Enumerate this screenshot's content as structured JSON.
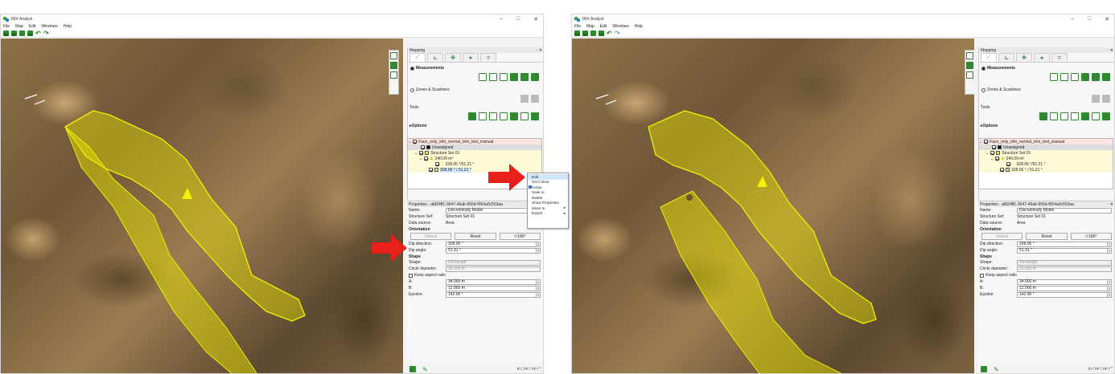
{
  "windows": [
    {
      "title": "IMX Analyst",
      "menu": [
        "File",
        "Map",
        "Edit",
        "Windows",
        "Help"
      ],
      "panel_title": "Mapping",
      "measurements_label": "Measurements",
      "zones_label": "Zones & Scanlines",
      "tools_label": "Tools",
      "options_label": "Options",
      "tree": {
        "root": "Face_only_sfm_normal_trim_test_manual",
        "unassigned": "Unassigned",
        "structure_set": "Structure Set 01",
        "area": "240.09 m²",
        "item1": "328.06 °/51.21 °",
        "item2": "328.06 ° / 51.21 °"
      },
      "properties_title": "Properties - afd24ff1-3647-46ab-956d-f054a0c553aa",
      "name_label": "Name:",
      "name_value": "Discontinuity Model",
      "structure_set_label": "Structure Set:",
      "structure_set_value": "Structure Set 01",
      "data_source_label": "Data source:",
      "data_source_value": "Area",
      "orientation_label": "Orientation",
      "unlock_label": "Unlock",
      "reset_label": "Reset",
      "rotate_label": "180°",
      "dip_direction_label": "Dip direction:",
      "dip_direction_value": "328.06 °",
      "dip_angle_label": "Dip angle:",
      "dip_angle_value": "51.31 °",
      "shape_section": "Shape",
      "shape_label": "Shape:",
      "shape_value": "Rectangle",
      "circle_label": "Circle diameter:",
      "circle_value": "25.000 m",
      "aspect_label": "Keep aspect ratio",
      "a_label": "A:",
      "a_value": "34.000 m",
      "b_label": "B:",
      "b_value": "12.000 m",
      "eps_label": "Epsilon:",
      "eps_value": "142.96 °",
      "units": "m / m² / m³ / °"
    },
    {
      "title": "IMX Analyst",
      "menu": [
        "File",
        "Map",
        "Edit",
        "Windows",
        "Help"
      ],
      "panel_title": "Mapping",
      "measurements_label": "Measurements",
      "zones_label": "Zones & Scanlines",
      "tools_label": "Tools",
      "options_label": "Options",
      "tree": {
        "root": "Face_only_sfm_normal_trim_test_manual",
        "unassigned": "Unassigned",
        "structure_set": "Structure Set 01",
        "area": "240.09 m²",
        "item1": "328.06 °/51.21 °",
        "item2": "328.06 ° / 51.21 °"
      },
      "properties_title": "Properties - afd24ff1-3647-46ab-956d-f054a0c553aa",
      "name_label": "Name:",
      "name_value": "Discontinuity Model",
      "structure_set_label": "Structure Set:",
      "structure_set_value": "Structure Set 01",
      "data_source_label": "Data source:",
      "data_source_value": "Area",
      "orientation_label": "Orientation",
      "unlock_label": "Unlock",
      "reset_label": "Reset",
      "rotate_label": "180°",
      "dip_direction_label": "Dip direction:",
      "dip_direction_value": "328.06 °",
      "dip_angle_label": "Dip angle:",
      "dip_angle_value": "51.31 °",
      "shape_section": "Shape",
      "shape_label": "Shape:",
      "shape_value": "Rectangle",
      "circle_label": "Circle diameter:",
      "circle_value": "25.000 m",
      "aspect_label": "Keep aspect ratio",
      "a_label": "A:",
      "a_value": "34.000 m",
      "b_label": "B:",
      "b_value": "12.000 m",
      "eps_label": "Epsilon:",
      "eps_value": "142.96 °",
      "units": "m / m² / m³ / °"
    }
  ],
  "context_menu": [
    {
      "label": "Edit",
      "highlighted": true
    },
    {
      "label": "Set Colour"
    },
    {
      "label": "Active",
      "checked": true
    },
    {
      "label": "Seek to"
    },
    {
      "label": "Delete"
    },
    {
      "label": "Show Properties"
    },
    {
      "label": "Move to",
      "submenu": true
    },
    {
      "label": "Export",
      "submenu": true
    }
  ],
  "colors": {
    "accent": "#2f8a2f",
    "highlight_arrow": "#e8201a",
    "overlay": "#e6e000"
  },
  "icons": [
    "app-icon",
    "open-icon",
    "save-icon",
    "print-icon",
    "undo-icon",
    "redo-icon"
  ]
}
